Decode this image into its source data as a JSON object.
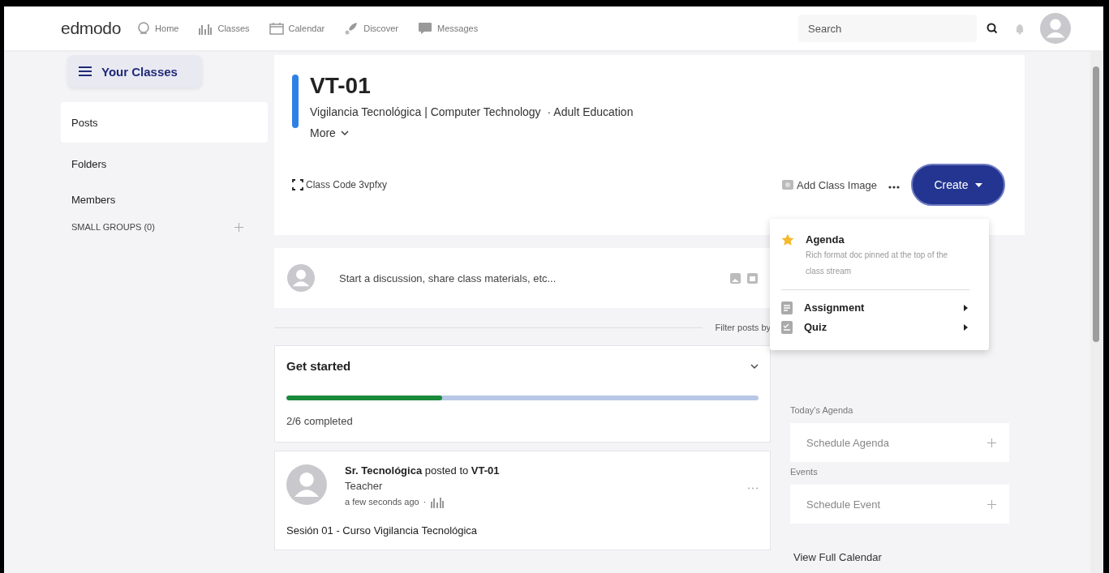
{
  "nav": {
    "logo": "edmodo",
    "links": [
      {
        "kind": "home",
        "label": "Home"
      },
      {
        "kind": "classes",
        "label": "Classes"
      },
      {
        "kind": "calendar",
        "label": "Calendar"
      },
      {
        "kind": "discover",
        "label": "Discover"
      },
      {
        "kind": "messages",
        "label": "Messages"
      }
    ],
    "search": {
      "placeholder": "Search"
    }
  },
  "sidebar": {
    "classes_button": "Your Classes",
    "items": [
      {
        "label": "Posts",
        "selected": true
      },
      {
        "label": "Folders",
        "selected": false
      },
      {
        "label": "Members",
        "selected": false
      }
    ],
    "small_groups": "SMALL GROUPS (0)"
  },
  "class": {
    "title": "VT-01",
    "subject": "Vigilancia Tecnológica | Computer Technology",
    "grade": "· Adult Education",
    "more": "More",
    "class_code": "Class Code 3vpfxy",
    "add_image": "Add Class Image",
    "create": "Create"
  },
  "create_menu": [
    {
      "kind": "agenda",
      "label": "Agenda",
      "description": "Rich format doc pinned at the top of the class stream",
      "submenu": false
    },
    {
      "kind": "assignment",
      "label": "Assignment",
      "submenu": true
    },
    {
      "kind": "quiz",
      "label": "Quiz",
      "submenu": true
    }
  ],
  "composer": {
    "placeholder": "Start a discussion, share class materials, etc..."
  },
  "filter": "Filter posts by",
  "get_started": {
    "title": "Get started",
    "level": 0.33,
    "progress": "2/6 completed"
  },
  "post": {
    "header": "**Sr. Tecnológica** posted to **VT-01**",
    "role": "Teacher",
    "time": "a few seconds ago",
    "separator": "·",
    "body": "Sesión 01 - Curso Vigilancia Tecnológica"
  },
  "calendar": {
    "sections": [
      {
        "title": "Today's Agenda",
        "action": "Schedule Agenda"
      },
      {
        "title": "Events",
        "action": "Schedule Event"
      }
    ],
    "link": "View Full Calendar"
  }
}
